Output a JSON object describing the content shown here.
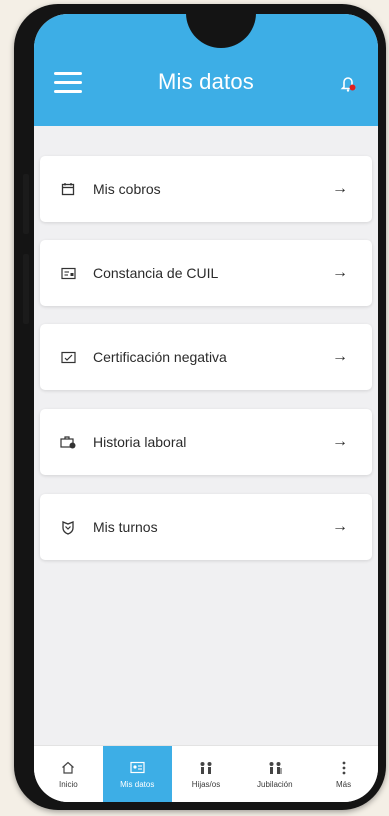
{
  "header": {
    "title": "Mis datos",
    "color": "#3daee6",
    "notification_dot_color": "#e02020"
  },
  "menu": [
    {
      "label": "Mis cobros",
      "icon": "calendar-icon",
      "arrow": "→"
    },
    {
      "label": "Constancia de CUIL",
      "icon": "id-card-icon",
      "arrow": "→"
    },
    {
      "label": "Certificación negativa",
      "icon": "document-check-icon",
      "arrow": "→"
    },
    {
      "label": "Historia laboral",
      "icon": "briefcase-icon",
      "arrow": "→"
    },
    {
      "label": "Mis turnos",
      "icon": "shield-icon",
      "arrow": "→"
    }
  ],
  "tabs": [
    {
      "label": "Inicio",
      "icon": "home-icon",
      "active": false
    },
    {
      "label": "Mis datos",
      "icon": "id-card-icon",
      "active": true
    },
    {
      "label": "Hijas/os",
      "icon": "family-icon",
      "active": false
    },
    {
      "label": "Jubilación",
      "icon": "elderly-icon",
      "active": false
    },
    {
      "label": "Más",
      "icon": "more-vertical-icon",
      "active": false
    }
  ]
}
